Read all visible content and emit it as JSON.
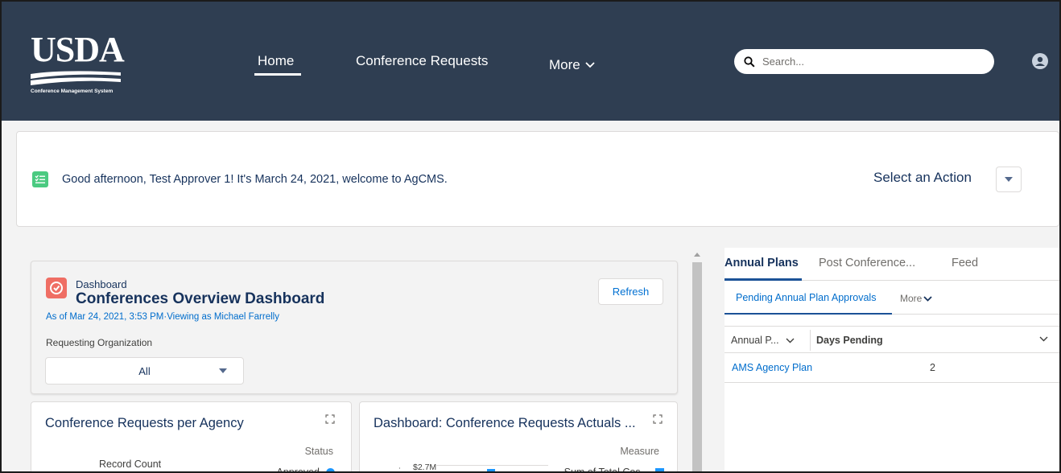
{
  "header": {
    "logo": {
      "wordmark": "USDA",
      "subtitle": "Conference Management System"
    },
    "nav": {
      "home": "Home",
      "conference_requests": "Conference Requests",
      "more": "More"
    },
    "search": {
      "placeholder": "Search..."
    },
    "icons": {
      "search": "search-icon",
      "avatar": "user-avatar-icon",
      "more_chevron": "chevron-down-icon"
    }
  },
  "banner": {
    "greeting": "Good afternoon, Test Approver 1! It's March 24, 2021, welcome to AgCMS.",
    "action_label": "Select an Action",
    "icon": "checklist-icon"
  },
  "dashboard": {
    "kicker": "Dashboard",
    "title": "Conferences Overview Dashboard",
    "as_of": "As of Mar 24, 2021, 3:53 PM·Viewing as Michael Farrelly",
    "refresh_label": "Refresh",
    "filter": {
      "label": "Requesting Organization",
      "value": "All"
    },
    "cards": [
      {
        "title": "Conference Requests per Agency",
        "legend_title": "Status",
        "axis_title": "Record Count",
        "legend_item": "Approved"
      },
      {
        "title": "Dashboard: Conference Requests Actuals ...",
        "legend_title": "Measure",
        "tick_label": "$2.7M",
        "legend_item": "Sum of Total Cos..."
      }
    ]
  },
  "right_panel": {
    "tabs": [
      "Annual Plans",
      "Post Conference...",
      "Feed"
    ],
    "subtabs": {
      "active": "Pending Annual Plan Approvals",
      "more": "More"
    },
    "table": {
      "columns": [
        "Annual P...",
        "Days Pending"
      ],
      "rows": [
        {
          "name": "AMS Agency Plan",
          "days": "2"
        }
      ]
    }
  },
  "colors": {
    "header_bg": "#2f3e52",
    "link": "#006dcc",
    "accent_green": "#4bca81",
    "dashboard_icon": "#ef6e64",
    "chart_blue": "#1b96ff"
  }
}
